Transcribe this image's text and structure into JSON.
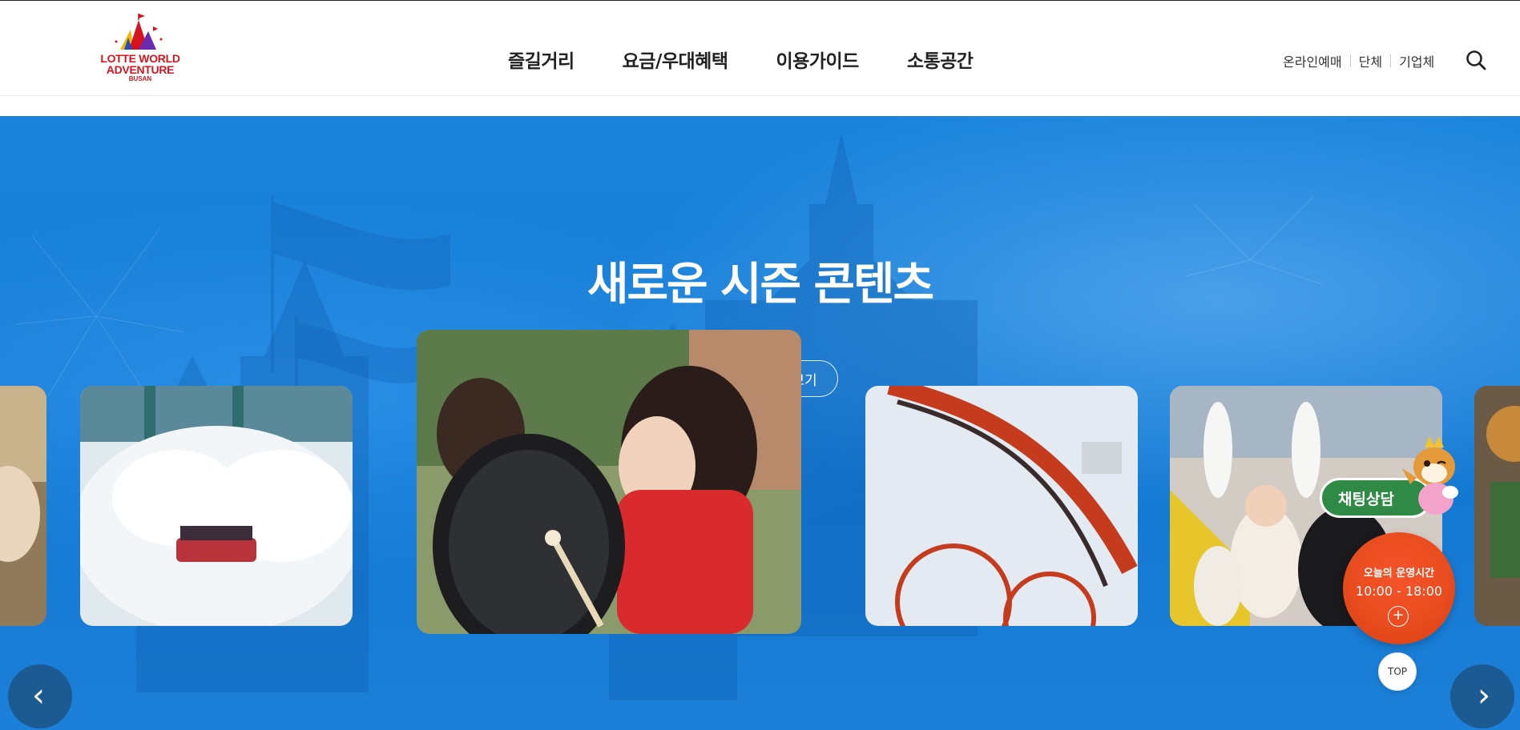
{
  "brand": {
    "line1": "LOTTE WORLD",
    "line2": "ADVENTURE",
    "line3": "BUSAN",
    "color": "#d6141f"
  },
  "nav": {
    "items": [
      {
        "label": "즐길거리"
      },
      {
        "label": "요금/우대혜택"
      },
      {
        "label": "이용가이드"
      },
      {
        "label": "소통공간"
      }
    ]
  },
  "util": {
    "links": [
      {
        "label": "온라인예매"
      },
      {
        "label": "단체"
      },
      {
        "label": "기업체"
      }
    ],
    "search_icon": "search-icon"
  },
  "hero": {
    "title": "새로운 시즌 콘텐츠",
    "more_button": "더 많은 콘텐츠 보기",
    "background_color": "#1578d2"
  },
  "carousel": {
    "prev_icon": "chevron-left-icon",
    "next_icon": "chevron-right-icon",
    "prev_glyph": "‹",
    "next_glyph": "›"
  },
  "floating": {
    "chat_label": "채팅상담",
    "chat_color": "#2f8a45",
    "hours_title": "오늘의 운영시간",
    "hours_value": "10:00 - 18:00",
    "hours_plus": "+",
    "hours_color": "#e94c1f",
    "top_label": "TOP"
  }
}
